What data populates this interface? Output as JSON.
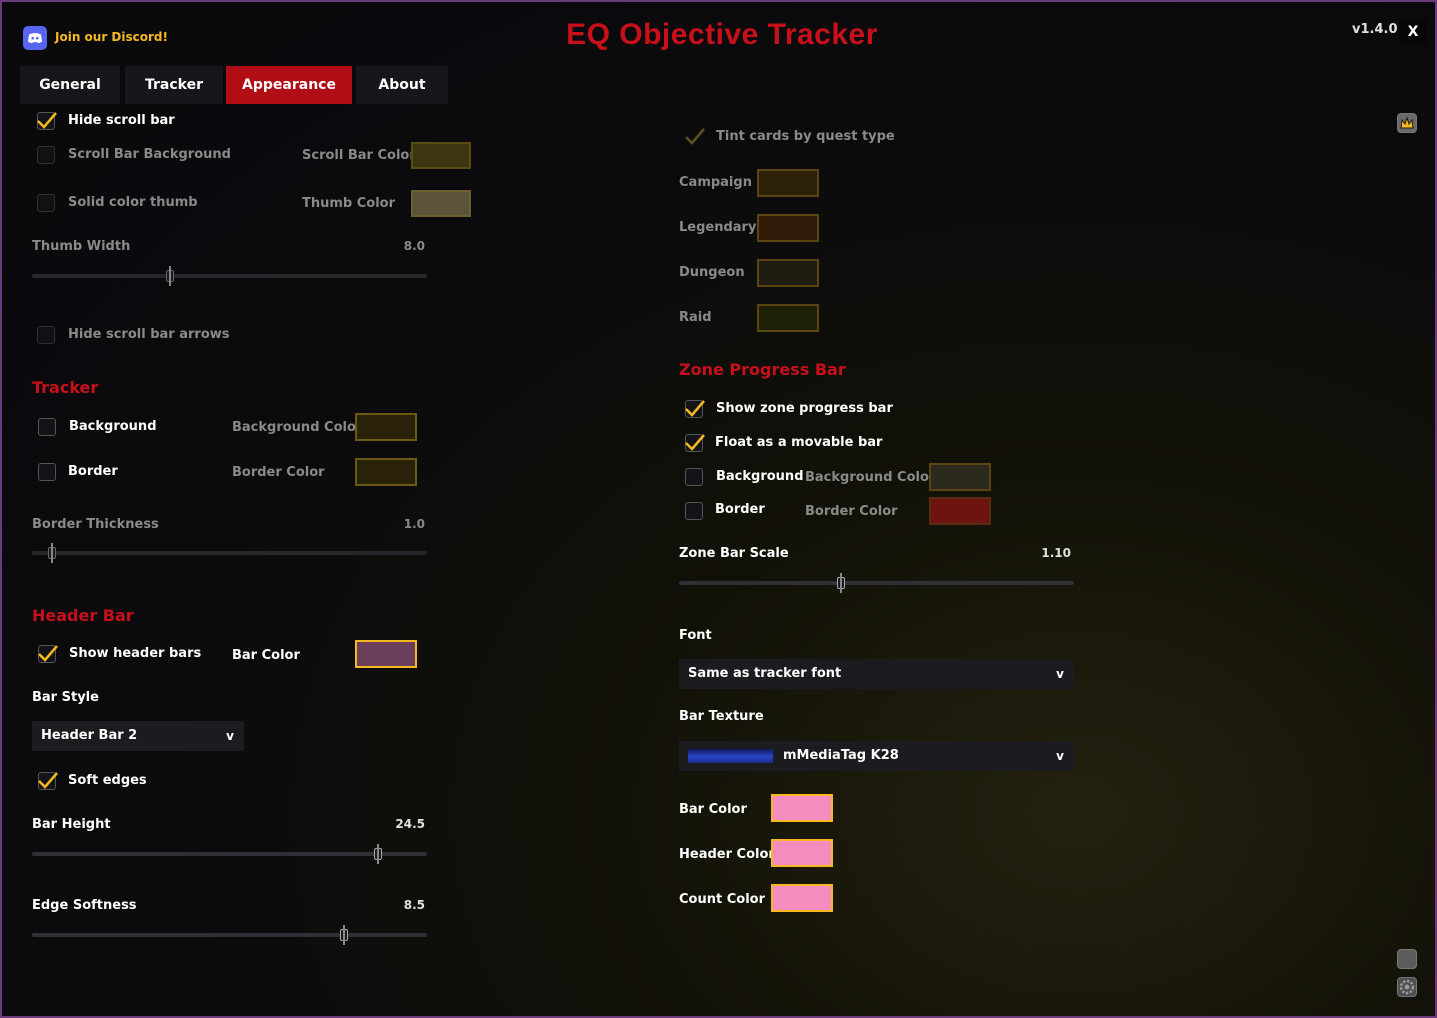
{
  "header": {
    "discord_label": "Join our Discord!",
    "title": "EQ Objective Tracker",
    "version": "v1.4.0",
    "close_label": "X"
  },
  "tabs": [
    {
      "label": "General",
      "active": false
    },
    {
      "label": "Tracker",
      "active": false
    },
    {
      "label": "Appearance",
      "active": true
    },
    {
      "label": "About",
      "active": false
    }
  ],
  "scrollbar": {
    "hide_scroll_bar": {
      "label": "Hide scroll bar",
      "checked": true
    },
    "scroll_bar_background": {
      "label": "Scroll Bar Background",
      "checked": false
    },
    "scroll_bar_color_label": "Scroll Bar Color",
    "solid_color_thumb": {
      "label": "Solid color thumb",
      "checked": false
    },
    "thumb_color_label": "Thumb Color",
    "thumb_width": {
      "label": "Thumb Width",
      "value": "8.0",
      "fraction": 0.35
    },
    "hide_scroll_bar_arrows": {
      "label": "Hide scroll bar arrows",
      "checked": false
    }
  },
  "tracker": {
    "section_title": "Tracker",
    "background": {
      "label": "Background",
      "checked": false
    },
    "background_color_label": "Background Color",
    "border": {
      "label": "Border",
      "checked": false
    },
    "border_color_label": "Border Color",
    "border_thickness": {
      "label": "Border Thickness",
      "value": "1.0",
      "fraction": 0.05
    }
  },
  "header_bar": {
    "section_title": "Header Bar",
    "show_header_bars": {
      "label": "Show header bars",
      "checked": true
    },
    "bar_color_label": "Bar Color",
    "bar_style_label": "Bar Style",
    "bar_style_value": "Header Bar 2",
    "soft_edges": {
      "label": "Soft edges",
      "checked": true
    },
    "bar_height": {
      "label": "Bar Height",
      "value": "24.5",
      "fraction": 0.875
    },
    "edge_softness": {
      "label": "Edge Softness",
      "value": "8.5",
      "fraction": 0.79
    }
  },
  "quest_types": {
    "tint_cards": {
      "label": "Tint cards by quest type",
      "checked": true
    },
    "items": [
      {
        "label": "Campaign"
      },
      {
        "label": "Legendary"
      },
      {
        "label": "Dungeon"
      },
      {
        "label": "Raid"
      }
    ]
  },
  "zone_progress": {
    "section_title": "Zone Progress Bar",
    "show_zone_progress_bar": {
      "label": "Show zone progress bar",
      "checked": true
    },
    "float_movable": {
      "label": "Float as a movable bar",
      "checked": true
    },
    "background": {
      "label": "Background",
      "checked": false
    },
    "background_color_label": "Background Color",
    "border": {
      "label": "Border",
      "checked": false
    },
    "border_color_label": "Border Color",
    "zone_bar_scale": {
      "label": "Zone Bar Scale",
      "value": "1.10",
      "fraction": 0.41
    },
    "font_label": "Font",
    "font_value": "Same as tracker font",
    "bar_texture_label": "Bar Texture",
    "bar_texture_value": "mMediaTag K28",
    "bar_color_label": "Bar Color",
    "header_color_label": "Header Color",
    "count_color_label": "Count Color"
  },
  "colors": {
    "accent_red": "#b00d15",
    "section_red": "#c8101a",
    "scroll_bar_color": "#3d3410",
    "thumb_color": "#5c5438",
    "tracker_background_color": "#2a2208",
    "tracker_border_color": "#2a2208",
    "header_bar_color": "#6b3f5c",
    "campaign_color": "#2d2108",
    "legendary_color": "#301b08",
    "dungeon_color": "#1e1d10",
    "raid_color": "#1f2107",
    "zone_background_color": "#2c2a1e",
    "zone_border_color": "#6e1410",
    "zone_bar_color": "#f48cc0",
    "zone_header_color": "#f48cc0",
    "zone_count_color": "#f48cc0"
  },
  "icons": {
    "discord": "discord-logo-icon",
    "check": "checkmark-icon",
    "chevron": "chevron-down-icon",
    "side_top": "crown-icon",
    "side_mid": "square-icon",
    "side_bottom": "gear-icon"
  }
}
